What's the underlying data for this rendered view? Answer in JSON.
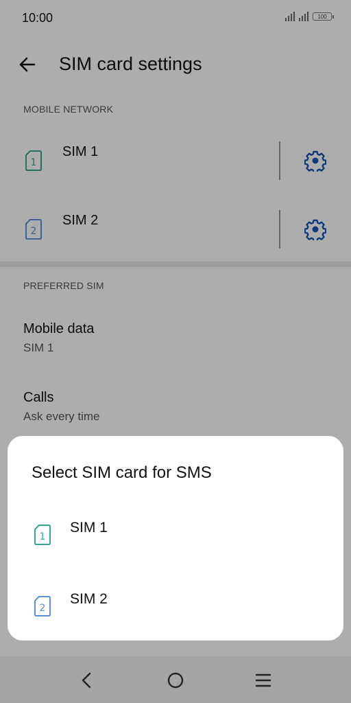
{
  "status_bar": {
    "time": "10:00",
    "battery": "100"
  },
  "header": {
    "title": "SIM card settings"
  },
  "mobile_network": {
    "section_label": "MOBILE NETWORK",
    "sims": [
      {
        "label": "SIM 1",
        "number": "1",
        "color": "#3aa38f"
      },
      {
        "label": "SIM 2",
        "number": "2",
        "color": "#5b8fd6"
      }
    ]
  },
  "preferred_sim": {
    "section_label": "PREFERRED SIM",
    "items": [
      {
        "title": "Mobile data",
        "value": "SIM 1"
      },
      {
        "title": "Calls",
        "value": "Ask every time"
      }
    ]
  },
  "dialog": {
    "title": "Select SIM card for SMS",
    "options": [
      {
        "label": "SIM 1",
        "number": "1",
        "color": "#3aa38f"
      },
      {
        "label": "SIM 2",
        "number": "2",
        "color": "#5b8fd6"
      }
    ]
  },
  "colors": {
    "accent": "#1a56b8",
    "scrim": "rgba(0,0,0,0.32)"
  },
  "icons": {
    "back": "arrow-left-icon",
    "settings": "gear-icon",
    "nav": [
      "back-icon",
      "home-icon",
      "menu-icon"
    ]
  }
}
